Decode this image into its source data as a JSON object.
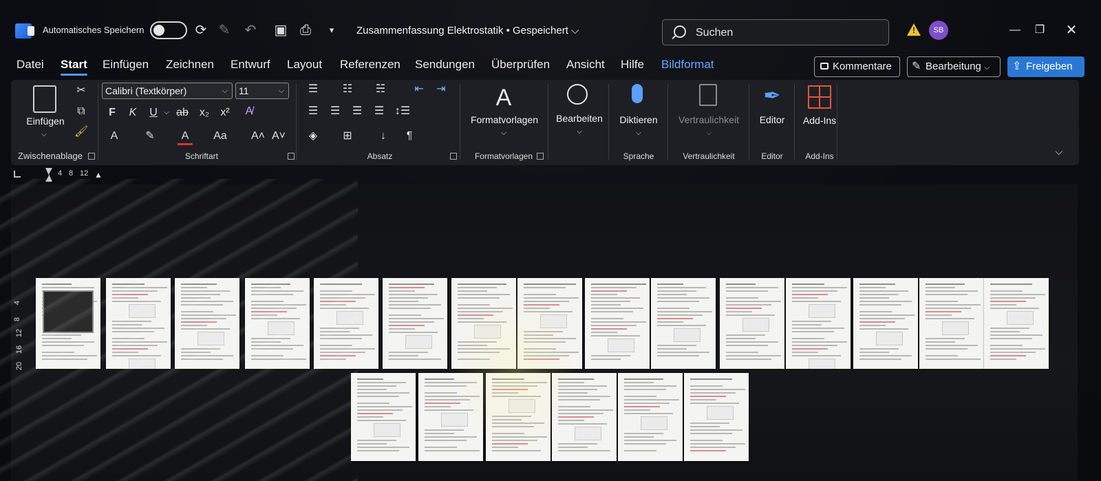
{
  "titlebar": {
    "autosave_label": "Automatisches Speichern",
    "document_title": "Zusammenfassung Elektrostatik • Gespeichert ⌵",
    "search_placeholder": "Suchen",
    "avatar_initials": "SB"
  },
  "menu": {
    "tabs": [
      "Datei",
      "Start",
      "Einfügen",
      "Zeichnen",
      "Entwurf",
      "Layout",
      "Referenzen",
      "Sendungen",
      "Überprüfen",
      "Ansicht",
      "Hilfe",
      "Bildformat"
    ],
    "active_tab": "Start",
    "contextual_tab": "Bildformat",
    "comments_label": "Kommentare",
    "editing_label": "Bearbeitung",
    "share_label": "Freigeben"
  },
  "ribbon": {
    "clipboard": {
      "paste_label": "Einfügen",
      "group_label": "Zwischenablage"
    },
    "font": {
      "font_name": "Calibri (Textkörper)",
      "font_size": "11",
      "group_label": "Schriftart",
      "bold": "F",
      "italic": "K",
      "underline": "U",
      "strike": "ab",
      "case": "Aa"
    },
    "paragraph": {
      "group_label": "Absatz"
    },
    "styles": {
      "button_label": "Formatvorlagen",
      "group_label": "Formatvorlagen"
    },
    "editing": {
      "button_label": "Bearbeiten"
    },
    "voice": {
      "button_label": "Diktieren",
      "group_label": "Sprache"
    },
    "sensitivity": {
      "button_label": "Vertraulichkeit",
      "group_label": "Vertraulichkeit"
    },
    "editor": {
      "button_label": "Editor",
      "group_label": "Editor"
    },
    "addins": {
      "button_label": "Add-Ins",
      "group_label": "Add-Ins"
    }
  },
  "ruler": {
    "h_numbers": [
      "4",
      "8",
      "12"
    ],
    "v_numbers": [
      "4",
      "8",
      "12",
      "16",
      "20"
    ]
  },
  "colors": {
    "accent": "#4e9bff",
    "share": "#2b78d4",
    "ribbon_bg": "#1e1f24",
    "avatar": "#7e4fc8",
    "warning": "#f2c12e"
  }
}
